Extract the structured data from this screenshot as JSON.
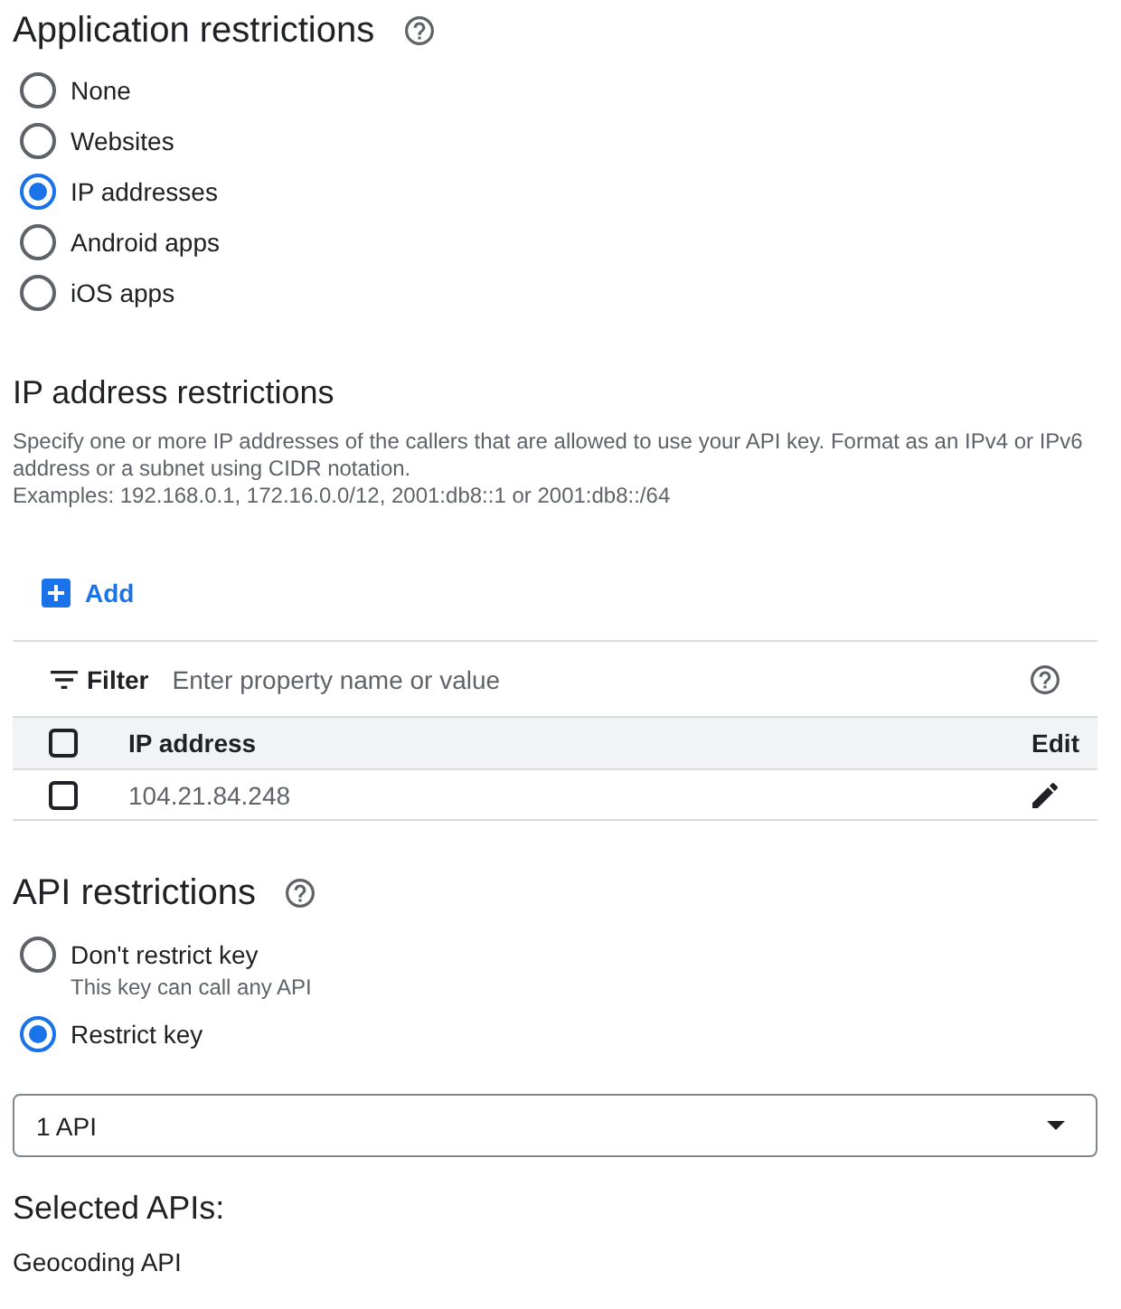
{
  "application_restrictions": {
    "title": "Application restrictions",
    "options": [
      {
        "label": "None",
        "selected": false
      },
      {
        "label": "Websites",
        "selected": false
      },
      {
        "label": "IP addresses",
        "selected": true
      },
      {
        "label": "Android apps",
        "selected": false
      },
      {
        "label": "iOS apps",
        "selected": false
      }
    ]
  },
  "ip_address_restrictions": {
    "title": "IP address restrictions",
    "description": [
      "Specify one or more IP addresses of the callers that are allowed to use your API key. Format as an IPv4 or IPv6 address or a subnet using CIDR notation.",
      "Examples: 192.168.0.1, 172.16.0.0/12, 2001:db8::1 or 2001:db8::/64"
    ],
    "add_button": "Add",
    "filter": {
      "label": "Filter",
      "placeholder": "Enter property name or value"
    },
    "table": {
      "select_all": {
        "checked": false
      },
      "columns": [
        "IP address",
        "Edit"
      ],
      "rows": [
        {
          "checked": false,
          "ip_address": "104.21.84.248"
        }
      ]
    }
  },
  "api_restrictions": {
    "title": "API restrictions",
    "options": [
      {
        "label": "Don't restrict key",
        "description": "This key can call any API",
        "selected": false
      },
      {
        "label": "Restrict key",
        "selected": true
      }
    ],
    "select": {
      "value": "1 API"
    }
  },
  "selected_apis": {
    "title": "Selected APIs:",
    "items": [
      "Geocoding API"
    ]
  }
}
